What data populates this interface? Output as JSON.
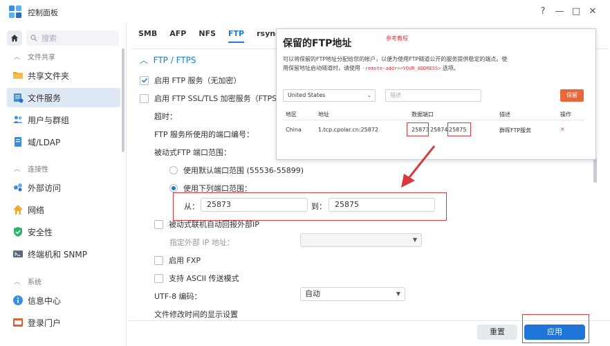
{
  "window": {
    "title": "控制面板",
    "controls": {
      "help": "?",
      "minimize": "—",
      "maximize": "□",
      "close": "✕"
    }
  },
  "sidebar": {
    "search_placeholder": "搜索",
    "groups": [
      {
        "label": "文件共享",
        "items": [
          {
            "label": "共享文件夹",
            "icon": "shared-folder-icon",
            "active": false
          },
          {
            "label": "文件服务",
            "icon": "file-services-icon",
            "active": true
          },
          {
            "label": "用户与群组",
            "icon": "users-icon",
            "active": false
          },
          {
            "label": "域/LDAP",
            "icon": "domain-icon",
            "active": false
          }
        ]
      },
      {
        "label": "连接性",
        "items": [
          {
            "label": "外部访问",
            "icon": "external-access-icon",
            "active": false
          },
          {
            "label": "网络",
            "icon": "network-icon",
            "active": false
          },
          {
            "label": "安全性",
            "icon": "security-icon",
            "active": false
          },
          {
            "label": "终端机和 SNMP",
            "icon": "terminal-icon",
            "active": false
          }
        ]
      },
      {
        "label": "系统",
        "items": [
          {
            "label": "信息中心",
            "icon": "info-center-icon",
            "active": false
          },
          {
            "label": "登录门户",
            "icon": "login-portal-icon",
            "active": false
          }
        ]
      }
    ]
  },
  "tabs": [
    "SMB",
    "AFP",
    "NFS",
    "FTP",
    "rsync"
  ],
  "active_tab": "FTP",
  "ftp": {
    "section_title": "FTP / FTPS",
    "enable_ftp": "启用 FTP 服务（无加密）",
    "enable_ftps": "启用 FTP SSL/TLS 加密服务（FTPS）",
    "timeout_label": "超时：",
    "port_label": "FTP 服务所使用的端口编号：",
    "passive_range_label": "被动式FTP 端口范围：",
    "default_range": "使用默认端口范围 (55536-55899)",
    "custom_range": "使用下列端口范围：",
    "from_label": "从：",
    "from_value": "25873",
    "to_label": "到：",
    "to_value": "25875",
    "report_external_ip": "被动式联机自动回报外部IP",
    "specify_external_ip": "指定外部 IP 地址：",
    "enable_fxp": "启用 FXP",
    "ascii_mode": "支持 ASCII 传送模式",
    "utf8_label": "UTF-8 编码：",
    "utf8_value": "自动",
    "modified_time_label": "文件修改时间的显示设置"
  },
  "footer": {
    "reset": "重置",
    "apply": "应用"
  },
  "popup": {
    "title": "保留的FTP地址",
    "ref": "参考教程",
    "desc1": "可以将保留的FTP地址分配给您的帐户，以便为使用FTP隧道公开的服务提供稳定的端点。使",
    "desc2_prefix": "用保留地址启动隧道时，请使用 ",
    "desc2_code": "-remote-addr=<YOUR_ADDRESS>",
    "desc2_suffix": " 选项。",
    "region_select": "United States",
    "desc_placeholder": "描述",
    "reserve_button": "保留",
    "headers": {
      "region": "地区",
      "address": "地址",
      "port": "数据端口",
      "description": "描述",
      "action": "操作"
    },
    "row": {
      "region": "China",
      "address": "1.tcp.cpolar.cn:25872",
      "port1": "25873",
      "port2": "25874",
      "port3": "25875",
      "description": "群晖FTP服务",
      "delete": "×"
    }
  },
  "colors": {
    "accent": "#1e7ad4",
    "annotation_red": "#d9363e",
    "reserve_orange": "#e9683a"
  }
}
